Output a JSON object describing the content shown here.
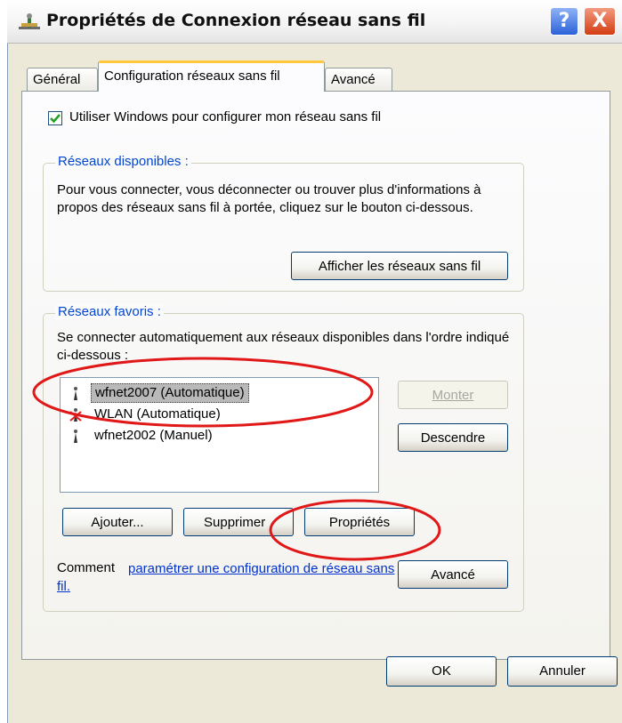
{
  "window": {
    "title": "Propriétés de Connexion réseau sans fil",
    "help_button": "?",
    "close_button": "X"
  },
  "tabs": [
    {
      "label": "Général",
      "active": false
    },
    {
      "label": "Configuration réseaux sans fil",
      "active": true
    },
    {
      "label": "Avancé",
      "active": false
    }
  ],
  "use_windows": {
    "label": "Utiliser Windows pour configurer mon réseau sans fil",
    "checked": true
  },
  "available": {
    "legend": "Réseaux disponibles :",
    "text": "Pour vous connecter, vous déconnecter ou trouver plus d'informations à propos des réseaux sans fil à portée, cliquez sur le bouton ci-dessous.",
    "show_button": "Afficher les réseaux sans fil"
  },
  "favorites": {
    "legend": "Réseaux favoris :",
    "text": "Se connecter automatiquement aux réseaux disponibles dans l'ordre indiqué ci-dessous :",
    "networks": [
      {
        "label": "wfnet2007 (Automatique)",
        "selected": true,
        "unavailable": false
      },
      {
        "label": "WLAN (Automatique)",
        "selected": false,
        "unavailable": true
      },
      {
        "label": "wfnet2002 (Manuel)",
        "selected": false,
        "unavailable": false
      }
    ],
    "move_up": "Monter",
    "move_down": "Descendre",
    "add": "Ajouter...",
    "remove": "Supprimer",
    "properties": "Propriétés",
    "help_prefix": "Comment",
    "help_link": "paramétrer une configuration de réseau sans fil.",
    "advanced": "Avancé"
  },
  "footer": {
    "ok": "OK",
    "cancel": "Annuler"
  },
  "colors": {
    "annotation": "#e01818",
    "link": "#0033cc",
    "legend": "#0046d5"
  }
}
